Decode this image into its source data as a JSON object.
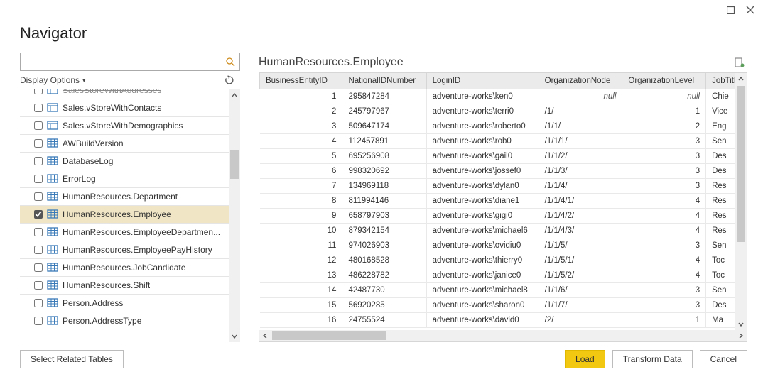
{
  "window": {
    "title": "Navigator"
  },
  "sidebar": {
    "search_placeholder": "",
    "display_options_label": "Display Options",
    "items": [
      {
        "label": "SalesStoreWithAddresses",
        "type": "view",
        "checked": false,
        "partial": true
      },
      {
        "label": "Sales.vStoreWithContacts",
        "type": "view",
        "checked": false
      },
      {
        "label": "Sales.vStoreWithDemographics",
        "type": "view",
        "checked": false
      },
      {
        "label": "AWBuildVersion",
        "type": "table",
        "checked": false
      },
      {
        "label": "DatabaseLog",
        "type": "table",
        "checked": false
      },
      {
        "label": "ErrorLog",
        "type": "table",
        "checked": false
      },
      {
        "label": "HumanResources.Department",
        "type": "table",
        "checked": false
      },
      {
        "label": "HumanResources.Employee",
        "type": "table",
        "checked": true,
        "selected": true
      },
      {
        "label": "HumanResources.EmployeeDepartmen...",
        "type": "table",
        "checked": false
      },
      {
        "label": "HumanResources.EmployeePayHistory",
        "type": "table",
        "checked": false
      },
      {
        "label": "HumanResources.JobCandidate",
        "type": "table",
        "checked": false
      },
      {
        "label": "HumanResources.Shift",
        "type": "table",
        "checked": false
      },
      {
        "label": "Person.Address",
        "type": "table",
        "checked": false
      },
      {
        "label": "Person.AddressType",
        "type": "table",
        "checked": false
      }
    ]
  },
  "preview": {
    "title": "HumanResources.Employee",
    "columns": [
      "BusinessEntityID",
      "NationalIDNumber",
      "LoginID",
      "OrganizationNode",
      "OrganizationLevel",
      "JobTitle"
    ],
    "rows": [
      {
        "BusinessEntityID": "1",
        "NationalIDNumber": "295847284",
        "LoginID": "adventure-works\\ken0",
        "OrganizationNode": "null",
        "OrganizationLevel": "null",
        "JobTitle": "Chie"
      },
      {
        "BusinessEntityID": "2",
        "NationalIDNumber": "245797967",
        "LoginID": "adventure-works\\terri0",
        "OrganizationNode": "/1/",
        "OrganizationLevel": "1",
        "JobTitle": "Vice"
      },
      {
        "BusinessEntityID": "3",
        "NationalIDNumber": "509647174",
        "LoginID": "adventure-works\\roberto0",
        "OrganizationNode": "/1/1/",
        "OrganizationLevel": "2",
        "JobTitle": "Eng"
      },
      {
        "BusinessEntityID": "4",
        "NationalIDNumber": "112457891",
        "LoginID": "adventure-works\\rob0",
        "OrganizationNode": "/1/1/1/",
        "OrganizationLevel": "3",
        "JobTitle": "Sen"
      },
      {
        "BusinessEntityID": "5",
        "NationalIDNumber": "695256908",
        "LoginID": "adventure-works\\gail0",
        "OrganizationNode": "/1/1/2/",
        "OrganizationLevel": "3",
        "JobTitle": "Des"
      },
      {
        "BusinessEntityID": "6",
        "NationalIDNumber": "998320692",
        "LoginID": "adventure-works\\jossef0",
        "OrganizationNode": "/1/1/3/",
        "OrganizationLevel": "3",
        "JobTitle": "Des"
      },
      {
        "BusinessEntityID": "7",
        "NationalIDNumber": "134969118",
        "LoginID": "adventure-works\\dylan0",
        "OrganizationNode": "/1/1/4/",
        "OrganizationLevel": "3",
        "JobTitle": "Res"
      },
      {
        "BusinessEntityID": "8",
        "NationalIDNumber": "811994146",
        "LoginID": "adventure-works\\diane1",
        "OrganizationNode": "/1/1/4/1/",
        "OrganizationLevel": "4",
        "JobTitle": "Res"
      },
      {
        "BusinessEntityID": "9",
        "NationalIDNumber": "658797903",
        "LoginID": "adventure-works\\gigi0",
        "OrganizationNode": "/1/1/4/2/",
        "OrganizationLevel": "4",
        "JobTitle": "Res"
      },
      {
        "BusinessEntityID": "10",
        "NationalIDNumber": "879342154",
        "LoginID": "adventure-works\\michael6",
        "OrganizationNode": "/1/1/4/3/",
        "OrganizationLevel": "4",
        "JobTitle": "Res"
      },
      {
        "BusinessEntityID": "11",
        "NationalIDNumber": "974026903",
        "LoginID": "adventure-works\\ovidiu0",
        "OrganizationNode": "/1/1/5/",
        "OrganizationLevel": "3",
        "JobTitle": "Sen"
      },
      {
        "BusinessEntityID": "12",
        "NationalIDNumber": "480168528",
        "LoginID": "adventure-works\\thierry0",
        "OrganizationNode": "/1/1/5/1/",
        "OrganizationLevel": "4",
        "JobTitle": "Toc"
      },
      {
        "BusinessEntityID": "13",
        "NationalIDNumber": "486228782",
        "LoginID": "adventure-works\\janice0",
        "OrganizationNode": "/1/1/5/2/",
        "OrganizationLevel": "4",
        "JobTitle": "Toc"
      },
      {
        "BusinessEntityID": "14",
        "NationalIDNumber": "42487730",
        "LoginID": "adventure-works\\michael8",
        "OrganizationNode": "/1/1/6/",
        "OrganizationLevel": "3",
        "JobTitle": "Sen"
      },
      {
        "BusinessEntityID": "15",
        "NationalIDNumber": "56920285",
        "LoginID": "adventure-works\\sharon0",
        "OrganizationNode": "/1/1/7/",
        "OrganizationLevel": "3",
        "JobTitle": "Des"
      },
      {
        "BusinessEntityID": "16",
        "NationalIDNumber": "24755524",
        "LoginID": "adventure-works\\david0",
        "OrganizationNode": "/2/",
        "OrganizationLevel": "1",
        "JobTitle": "Ma"
      }
    ]
  },
  "footer": {
    "select_related": "Select Related Tables",
    "load": "Load",
    "transform": "Transform Data",
    "cancel": "Cancel"
  }
}
